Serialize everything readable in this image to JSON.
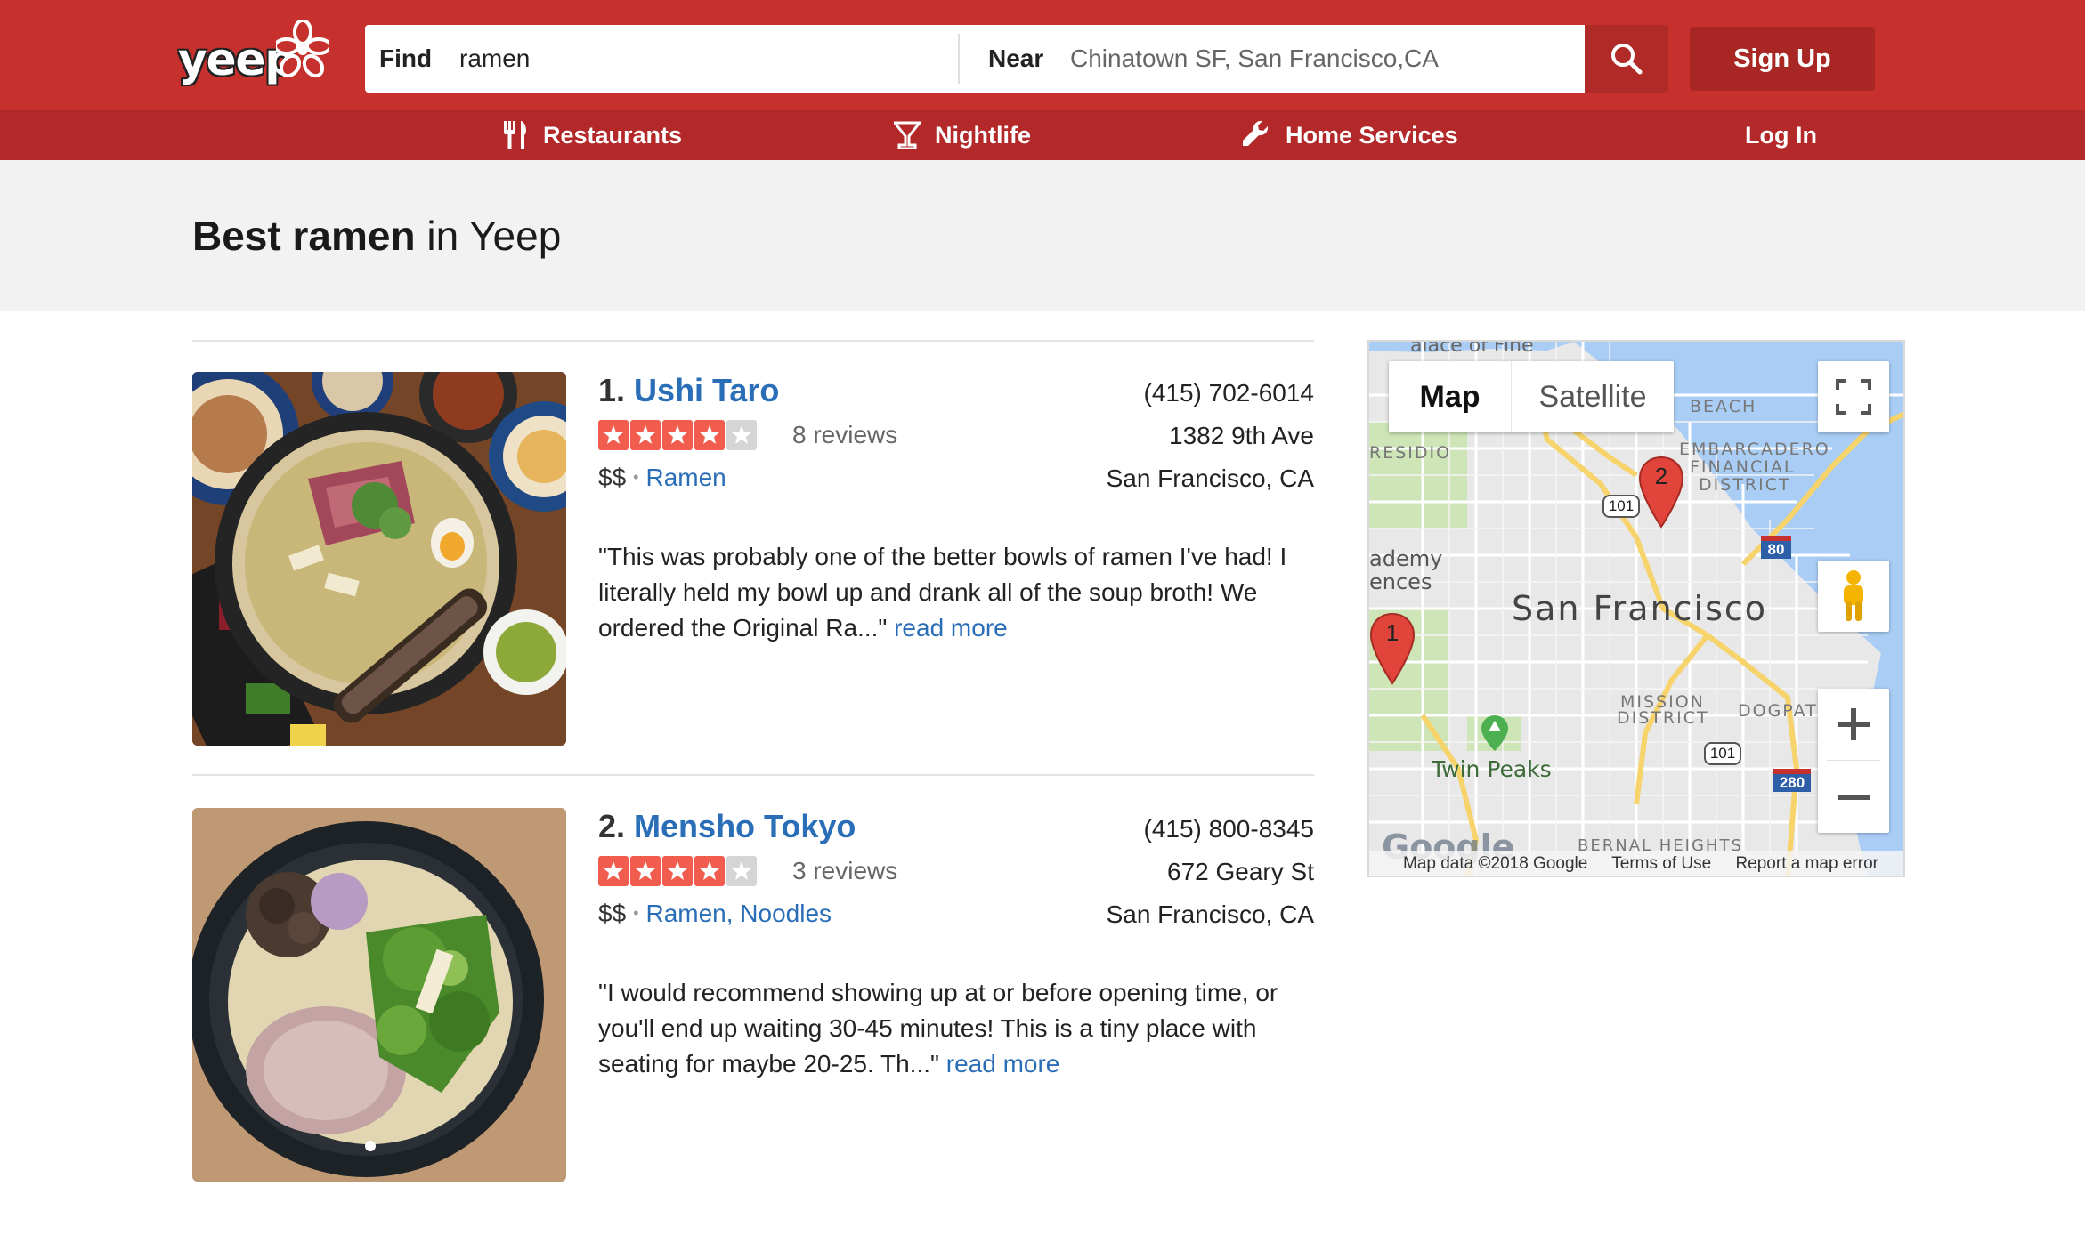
{
  "header": {
    "logo_text": "yeep",
    "find_label": "Find",
    "find_value": "ramen",
    "near_label": "Near",
    "near_value": "Chinatown SF, San Francisco,CA",
    "signup_label": "Sign Up",
    "accent_color": "#c6302d"
  },
  "nav": {
    "restaurants": "Restaurants",
    "nightlife": "Nightlife",
    "home_services": "Home Services",
    "login": "Log In"
  },
  "title": {
    "bold": "Best ramen",
    "rest": " in Yeep"
  },
  "results": [
    {
      "rank": "1.",
      "name": "Ushi Taro",
      "rating": 4,
      "rating_max": 5,
      "reviews": "8 reviews",
      "price": "$$",
      "categories": [
        "Ramen"
      ],
      "phone": "(415) 702-6014",
      "address": "1382 9th Ave",
      "city": "San Francisco, CA",
      "snippet": "\"This was probably one of the better bowls of ramen I've had! I literally held my bowl up and drank all of the soup broth! We ordered the Original Ra...\"",
      "read_more": "read more"
    },
    {
      "rank": "2.",
      "name": "Mensho Tokyo",
      "rating": 4,
      "rating_max": 5,
      "reviews": "3 reviews",
      "price": "$$",
      "categories": [
        "Ramen",
        "Noodles"
      ],
      "phone": "(415) 800-8345",
      "address": "672 Geary St",
      "city": "San Francisco, CA",
      "snippet": "\"I would recommend showing up at or before opening time, or you'll end up waiting 30-45 minutes! This is a tiny place with seating for maybe 20-25. Th...\"",
      "read_more": "read more"
    }
  ],
  "map": {
    "tab_map": "Map",
    "tab_satellite": "Satellite",
    "city_label": "San Francisco",
    "labels": [
      "BEACH",
      "EMBARCADERO",
      "FINANCIAL",
      "DISTRICT",
      "RESIDIO",
      "ademy",
      "ences",
      "MISSION",
      "DISTRICT",
      "DOGPAT",
      "Twin Peaks",
      "BERNAL HEIGHTS",
      "alace of Fine"
    ],
    "highway_labels": [
      "101",
      "80",
      "101",
      "280"
    ],
    "pins": [
      "1",
      "2"
    ],
    "google_logo": "Google",
    "attribution": "Map data ©2018 Google",
    "terms": "Terms of Use",
    "report": "Report a map error"
  }
}
